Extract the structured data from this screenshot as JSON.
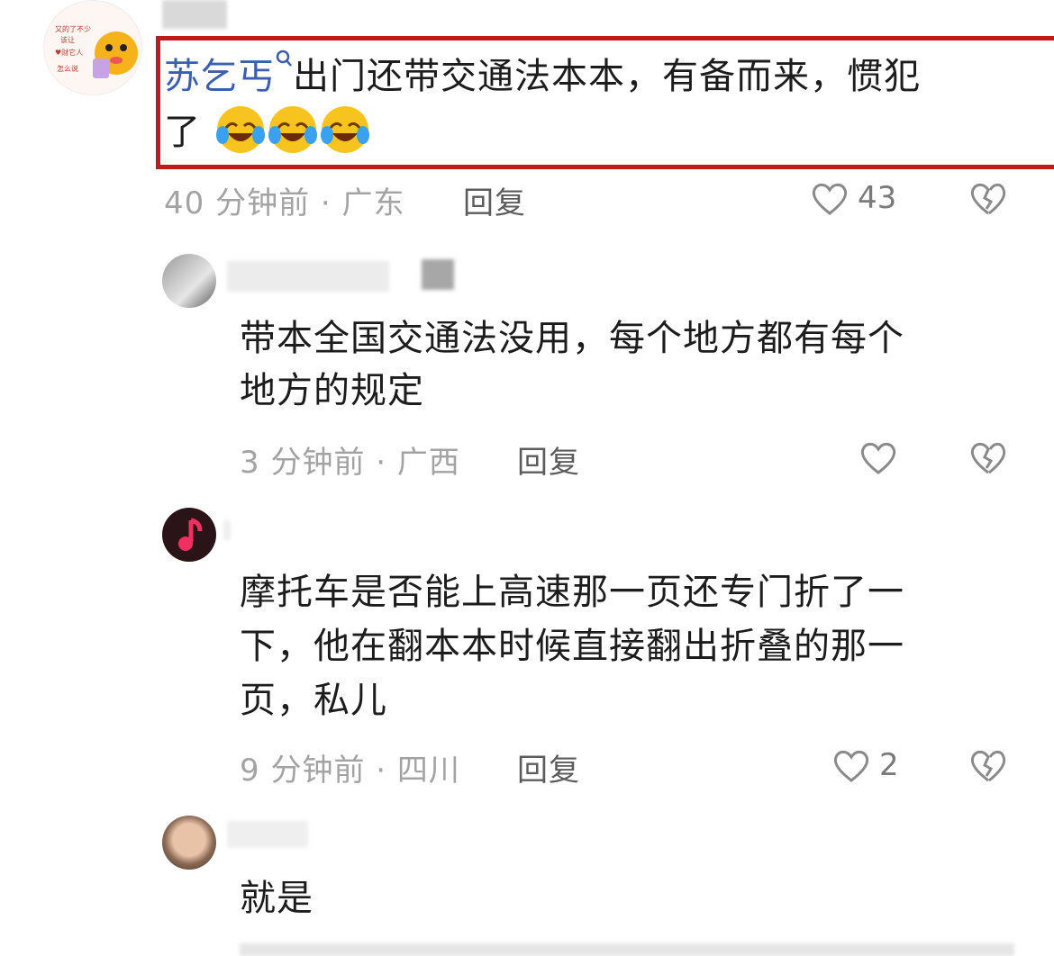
{
  "comments": [
    {
      "username": "苏乞丐",
      "text_line1": "出门还带交通法本本，有备而来，惯犯",
      "text_line2": "了",
      "emoji": "laughing-tears-emoji",
      "time": "40 分钟前",
      "location": "广东",
      "reply_label": "回复",
      "likes": "43"
    },
    {
      "text_line1": "带本全国交通法没用，每个地方都有每个",
      "text_line2": "地方的规定",
      "time": "3 分钟前",
      "location": "广西",
      "reply_label": "回复",
      "likes": ""
    },
    {
      "text_line1": "摩托车是否能上高速那一页还专门折了一",
      "text_line2": "下，他在翻本本时候直接翻出折叠的那一",
      "text_line3": "页，私儿",
      "time": "9 分钟前",
      "location": "四川",
      "reply_label": "回复",
      "likes": "2"
    },
    {
      "text_line1": "就是"
    }
  ],
  "dot_separator": "·",
  "colors": {
    "highlight_border": "#c11a1a",
    "username": "#3b5fb0",
    "meta": "#a3a3a3"
  },
  "icons": [
    "search-icon",
    "heart-icon",
    "broken-heart-icon",
    "music-note-icon"
  ]
}
